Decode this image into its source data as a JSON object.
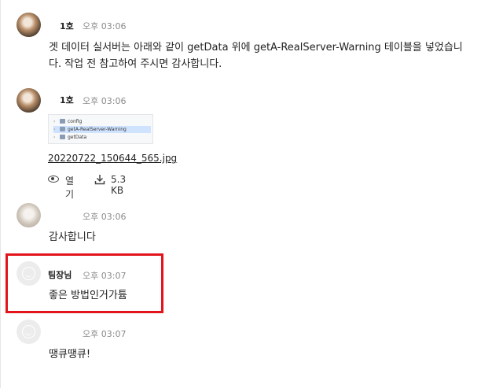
{
  "messages": [
    {
      "id": "m1",
      "sender": "1호",
      "time": "오후 03:06",
      "text_lines": [
        "겟 데이터 실서버는 아래와 같이 getData 위에 getA-RealServer-Warning 테이블을 넣었습니",
        "다. 작업 전 참고하여 주시면 감사합니다."
      ]
    },
    {
      "id": "m2",
      "sender": "1호",
      "time": "오후 03:06",
      "attachment": {
        "tree_items": [
          {
            "label": "config",
            "selected": false
          },
          {
            "label": "getA-RealServer-Warning",
            "selected": true
          },
          {
            "label": "getData",
            "selected": false
          }
        ],
        "filename": "20220722_150644_565.jpg",
        "open_label": "열기",
        "size": "5.3 KB"
      }
    },
    {
      "id": "m3",
      "sender": "",
      "time": "오후 03:06",
      "text": "감사합니다"
    },
    {
      "id": "m4",
      "sender": "팀장님",
      "time": "오후 03:07",
      "text": "좋은 방법인거가튬"
    },
    {
      "id": "m5",
      "sender": "",
      "time": "오후 03:07",
      "text": "땡큐땡큐!"
    }
  ],
  "colors": {
    "highlight_border": "#e3131c",
    "time_text": "#8a8a8a",
    "selected_row": "#cfe3ff"
  },
  "icons": {
    "open": "eye-icon",
    "size": "download-icon",
    "default_avatar": "smiley-avatar-icon"
  }
}
